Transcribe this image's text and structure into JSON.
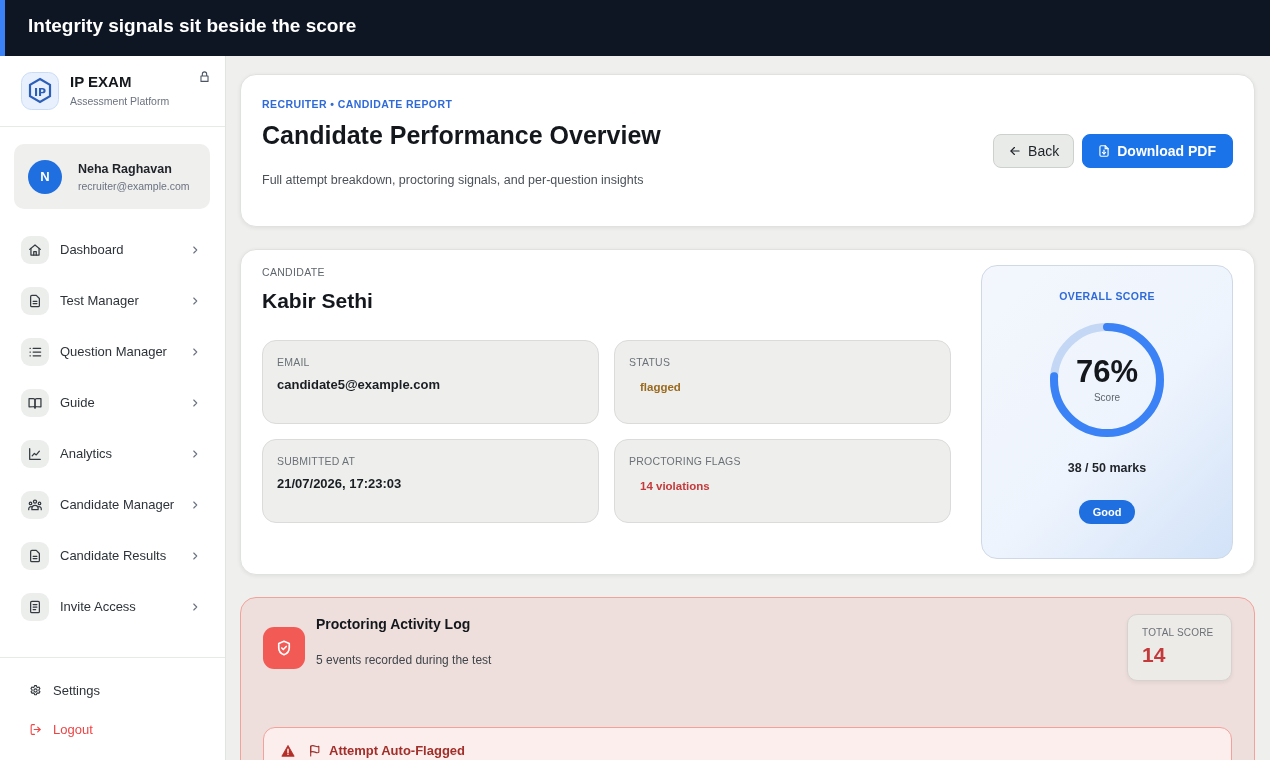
{
  "banner": {
    "title": "Integrity signals sit beside the score"
  },
  "sidebar": {
    "brand": {
      "logo_mark": "IP",
      "name": "IP EXAM",
      "tagline": "Assessment Platform"
    },
    "user": {
      "initial": "N",
      "name": "Neha Raghavan",
      "email": "recruiter@example.com"
    },
    "nav": [
      {
        "label": "Dashboard"
      },
      {
        "label": "Test Manager"
      },
      {
        "label": "Question Manager"
      },
      {
        "label": "Guide"
      },
      {
        "label": "Analytics"
      },
      {
        "label": "Candidate Manager"
      },
      {
        "label": "Candidate Results"
      },
      {
        "label": "Invite Access"
      }
    ],
    "footer": [
      {
        "label": "Settings",
        "kind": "plain"
      },
      {
        "label": "Logout",
        "kind": "danger"
      }
    ]
  },
  "header": {
    "eyebrow": "RECRUITER • CANDIDATE REPORT",
    "title": "Candidate Performance Overview",
    "subtitle": "Full attempt breakdown, proctoring signals, and per-question insights",
    "buttons": [
      {
        "label": "Back",
        "kind": "secondary"
      },
      {
        "label": "Download PDF",
        "kind": "primary"
      }
    ]
  },
  "candidate": {
    "label": "CANDIDATE",
    "name": "Kabir Sethi",
    "fields": [
      {
        "label": "EMAIL",
        "value": "candidate5@example.com",
        "kind": "text"
      },
      {
        "label": "STATUS",
        "value": "flagged",
        "kind": "warning"
      },
      {
        "label": "SUBMITTED AT",
        "value": "21/07/2026, 17:23:03",
        "kind": "text"
      },
      {
        "label": "PROCTORING FLAGS",
        "value": "14 violations",
        "kind": "danger"
      }
    ]
  },
  "score": {
    "label": "OVERALL SCORE",
    "value": "76%",
    "caption": "Score",
    "level": 0.76,
    "marks": "38 / 50 marks",
    "grade": "Good"
  },
  "proctoring": {
    "title": "Proctoring Activity Log",
    "subtitle": "5 events recorded during the test",
    "total": {
      "label": "TOTAL SCORE",
      "value": "14"
    },
    "alerts": [
      {
        "title": "Attempt Auto-Flagged"
      }
    ]
  }
}
